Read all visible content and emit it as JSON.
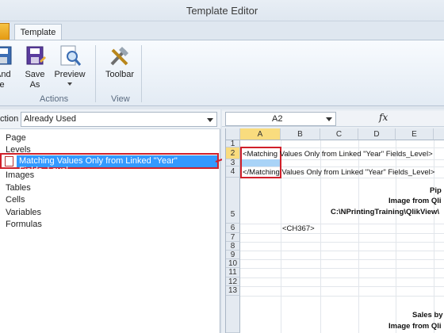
{
  "window": {
    "title": "Template Editor"
  },
  "ribbon": {
    "tabs": [
      {
        "label": "Template"
      }
    ],
    "buttons": [
      {
        "label": "And\nse"
      },
      {
        "label": "Save\nAs"
      },
      {
        "label": "Preview"
      },
      {
        "label": "Toolbar"
      }
    ],
    "groups": [
      {
        "label": "Actions"
      },
      {
        "label": "View"
      }
    ]
  },
  "left": {
    "section_label": "ction",
    "section_value": "Already Used",
    "tree": [
      {
        "label": "Page"
      },
      {
        "label": "Levels"
      },
      {
        "label": "Matching Values Only from Linked \"Year\" Fields_Level"
      },
      {
        "label": "Images"
      },
      {
        "label": "Tables"
      },
      {
        "label": "Cells"
      },
      {
        "label": "Variables"
      },
      {
        "label": "Formulas"
      }
    ]
  },
  "sheet": {
    "name_box": "A2",
    "fx": "fx",
    "columns": [
      "A",
      "B",
      "C",
      "D",
      "E"
    ],
    "rows": [
      "1",
      "2",
      "3",
      "4",
      "5",
      "6",
      "7",
      "8",
      "9",
      "10",
      "11",
      "12",
      "13"
    ],
    "cells": {
      "r2": "<Matching Values Only from Linked \"Year\" Fields_Level>",
      "r4": "</Matching Values Only from Linked \"Year\" Fields_Level>",
      "r5a": "Pip",
      "r5b": "Image from Qli",
      "r5c": "C:\\NPrintingTraining\\QlikView\\",
      "r6": "<CH367>",
      "r14a": "Sales by",
      "r14b": "Image from Qli"
    }
  }
}
